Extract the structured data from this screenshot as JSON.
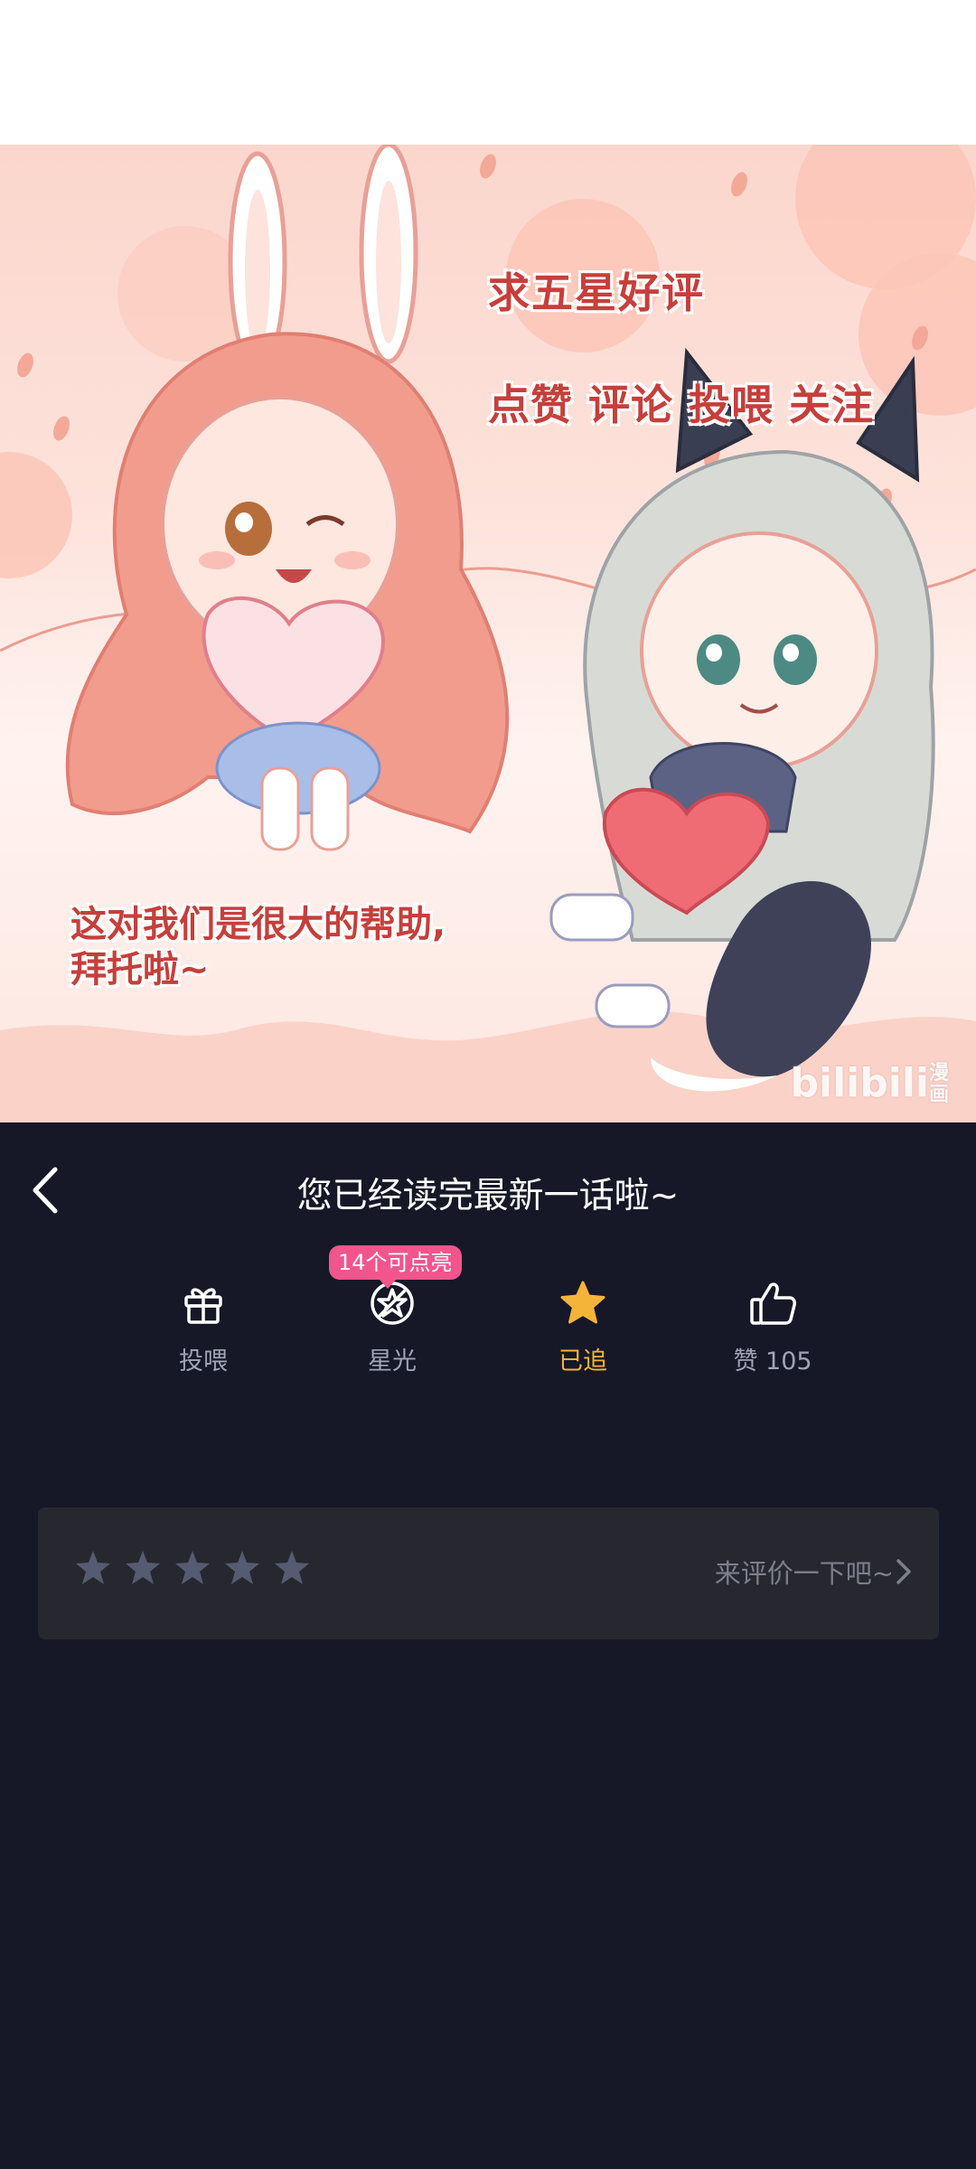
{
  "artwork": {
    "line1": "求五星好评",
    "line2": "点赞 评论 投喂 关注",
    "line3": "这对我们是很大的帮助,",
    "line4": "拜托啦~",
    "watermark_logo": "bilibili",
    "watermark_text": "漫画"
  },
  "nav": {
    "back_icon": "chevron-left-icon",
    "title": "您已经读完最新一话啦~"
  },
  "actions": [
    {
      "icon": "gift-icon",
      "label": "投喂"
    },
    {
      "icon": "starlight-icon",
      "label": "星光",
      "badge": "14个可点亮"
    },
    {
      "icon": "star-filled-icon",
      "label": "已追",
      "active_color": "#f4b43a"
    },
    {
      "icon": "thumbs-up-icon",
      "label": "赞 105"
    }
  ],
  "rating": {
    "stars_total": 5,
    "stars_filled": 0,
    "prompt": "来评价一下吧~",
    "chevron_icon": "chevron-right-icon"
  },
  "colors": {
    "background": "#161827",
    "accent_badge": "#f2558b",
    "followed": "#f4b43a",
    "card": "#27282f"
  }
}
